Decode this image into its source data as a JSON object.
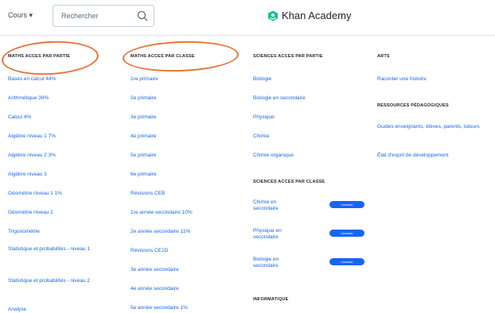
{
  "header": {
    "courses_label": "Cours",
    "search_placeholder": "Rechercher",
    "logo_text": "Khan Academy"
  },
  "col1": {
    "heading": "MATHS ACCES PAR PARTIE",
    "items": [
      "Bases en calcul 44%",
      "Arithmétique 39%",
      "Calcul 4%",
      "Algèbre niveau 1 7%",
      "Algèbre niveau 2 3%",
      "Algèbre niveau 3",
      "Géométrie niveau 1 1%",
      "Géométrie niveau 2",
      "Trigonométrie",
      "Statistique et probabilités - niveau 1",
      "Statistique et probabilités - niveau 2",
      "Analyse"
    ]
  },
  "col2": {
    "heading": "MATHS ACCES PAR CLASSE",
    "items": [
      "1re primaire",
      "2e primaire",
      "3e primaire",
      "4e primaire",
      "5e primaire",
      "6e primaire",
      "Révisions CEB",
      "1re année secondaire 10%",
      "2e année secondaire 11%",
      "Révisions CE1D",
      "3e année secondaire",
      "4e année secondaire",
      "5e année secondaire 1%"
    ]
  },
  "col3": {
    "heading": "SCIENCES ACCES PAR PARTIE",
    "items": [
      "Biologie",
      "Biologie en secondaire",
      "Physique",
      "Chimie",
      "Chimie organique"
    ],
    "heading2": "SCIENCES ACCES PAR CLASSE",
    "items2": [
      "Chimie en secondaire",
      "Physique en secondaire",
      "Biologie en secondaire"
    ],
    "badge": "nouveau",
    "heading3": "INFORMATIQUE"
  },
  "col4": {
    "heading": "ARTS",
    "items": [
      "Raconter une histoire"
    ],
    "heading2": "RESSOURCES PÉDAGOGIQUES",
    "items2": [
      "Guides enseignants, élèves, parents, tuteurs",
      "État d'esprit de développement"
    ]
  },
  "colors": {
    "link": "#1865f2",
    "annotation": "#e8763c",
    "logo": "#14bf96"
  }
}
